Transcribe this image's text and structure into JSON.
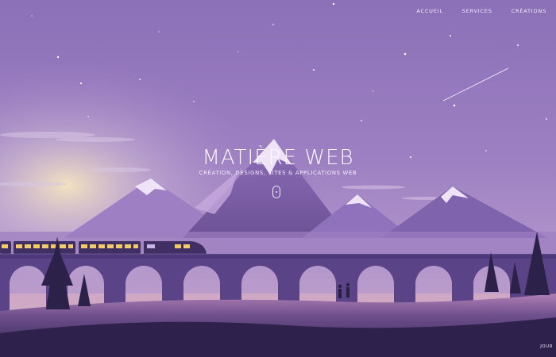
{
  "nav": {
    "items": [
      {
        "label": "ACCUEIL"
      },
      {
        "label": "SERVICES"
      },
      {
        "label": "CRÉATIONS"
      }
    ]
  },
  "hero": {
    "title": "MATIÈRE WEB",
    "subtitle": "CRÉATION, DESIGNS, SITES & APPLICATIONS WEB"
  },
  "corner": {
    "label": "JOUR"
  },
  "colors": {
    "sky_top": "#8a6fb6",
    "sky_mid": "#a98ac8",
    "horizon_glow": "#f2d9b0",
    "mountain": "#7b5fa8",
    "snow": "#efe4f7",
    "viaduct": "#4e3a7a",
    "ground": "#3a2a5e"
  },
  "icons": [
    "scroll-mouse-icon",
    "star-icon",
    "shooting-star-icon",
    "train-icon"
  ]
}
